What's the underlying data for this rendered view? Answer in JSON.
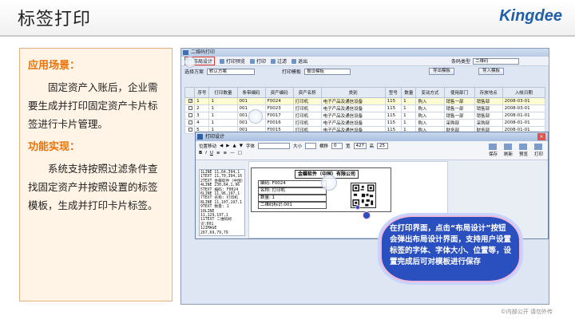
{
  "slide": {
    "title": "标签打印",
    "logo": "Kingdee",
    "footer": "©内部公开 请勿外传"
  },
  "left_panel": {
    "scenario_title": "应用场景：",
    "scenario_text": "固定资产入账后，企业需要生成并打印固定资产卡片标签进行卡片管理。",
    "function_title": "功能实现：",
    "function_text": "系统支持按照过滤条件查找固定资产并按照设置的标签模板，生成并打印卡片标签。"
  },
  "main_window": {
    "title": "二维码打印",
    "toolbar": [
      "布局设计",
      "打印预览",
      "打印",
      "过滤",
      "退出"
    ],
    "condition_type_label": "条码类型",
    "condition_type_value": "二维码",
    "scheme_label": "选择方案",
    "scheme_value": "默认方案",
    "template_label": "打印模板",
    "template_value": "报设模板",
    "btn_export": "导出模板",
    "btn_import": "导入模板",
    "columns": [
      "",
      "序号",
      "打印数量",
      "条带编码",
      "资产编码",
      "资产名称",
      "类别",
      "型号",
      "数量",
      "变动方式",
      "使用部门",
      "存放地点",
      "入帐日期"
    ],
    "rows": [
      {
        "checked": true,
        "cells": [
          "1",
          "1",
          "001",
          "F0024",
          "打印机",
          "电子产品及通信设备",
          "115",
          "1",
          "购入",
          "销售一部",
          "销售部",
          "2008-03-01"
        ]
      },
      {
        "checked": false,
        "cells": [
          "2",
          "1",
          "001",
          "F0023",
          "打印机",
          "电子产品及通信设备",
          "115",
          "1",
          "购入",
          "销售一部",
          "销售部",
          "2008-03-01"
        ]
      },
      {
        "checked": false,
        "cells": [
          "3",
          "1",
          "001",
          "F0017",
          "打印机",
          "电子产品及通信设备",
          "115",
          "1",
          "购入",
          "销售一部",
          "销售部",
          "2008-01-01"
        ]
      },
      {
        "checked": false,
        "cells": [
          "4",
          "1",
          "001",
          "F0016",
          "打印机",
          "电子产品及通信设备",
          "115",
          "1",
          "购入",
          "采购部",
          "采购部",
          "2008-01-01"
        ]
      },
      {
        "checked": false,
        "cells": [
          "5",
          "1",
          "001",
          "F0015",
          "打印机",
          "电子产品及通信设备",
          "115",
          "1",
          "购入",
          "财务部",
          "财务部",
          "2008-01-01"
        ]
      }
    ]
  },
  "print_window": {
    "title": "打印设计",
    "close": "×",
    "move_label": "位置移动",
    "font_label": "字体",
    "size_label": "大小",
    "offset_x_label": "横移",
    "offset_x_value": "0",
    "width_label": "宽",
    "width_value": "427",
    "height_label": "高",
    "height_value": "25",
    "right_tools": [
      "保存",
      "刷新",
      "预览",
      "打印"
    ],
    "code_lines": [
      "1LINE 11,64,394,1",
      "1TEXT 11,70,394,16",
      "2TEXT 金蝶软件（中国）",
      "4LINE 230,64,1,96",
      "5TEXT 编码: F0024",
      "6LINE 11,96,197,1",
      "7TEXT 名称: 打印机",
      "8LINE 11,107,197,1",
      "9TEXT 数量: 1",
      "10LINE 11,129,197,1",
      "11TEXT 二维码标识:001",
      "12IMAGE 267,69,79,79"
    ],
    "label": {
      "company": "金蝶软件（中国）有限公司",
      "code_line": "编码: F0024",
      "name_line": "名称: 打印机",
      "qty_line": "数量: 1",
      "qr_line": "二维码标识:001"
    }
  },
  "callout": {
    "text": "在打印界面，点击“布局设计”按钮会弹出布局设计界面，支持用户设置标签的字体、字体大小、位置等，设置完成后可对模板进行保存"
  },
  "colors": {
    "accent_orange": "#e8740c",
    "callout_blue": "#2a4fbf",
    "brand_blue": "#1f5fa8"
  }
}
